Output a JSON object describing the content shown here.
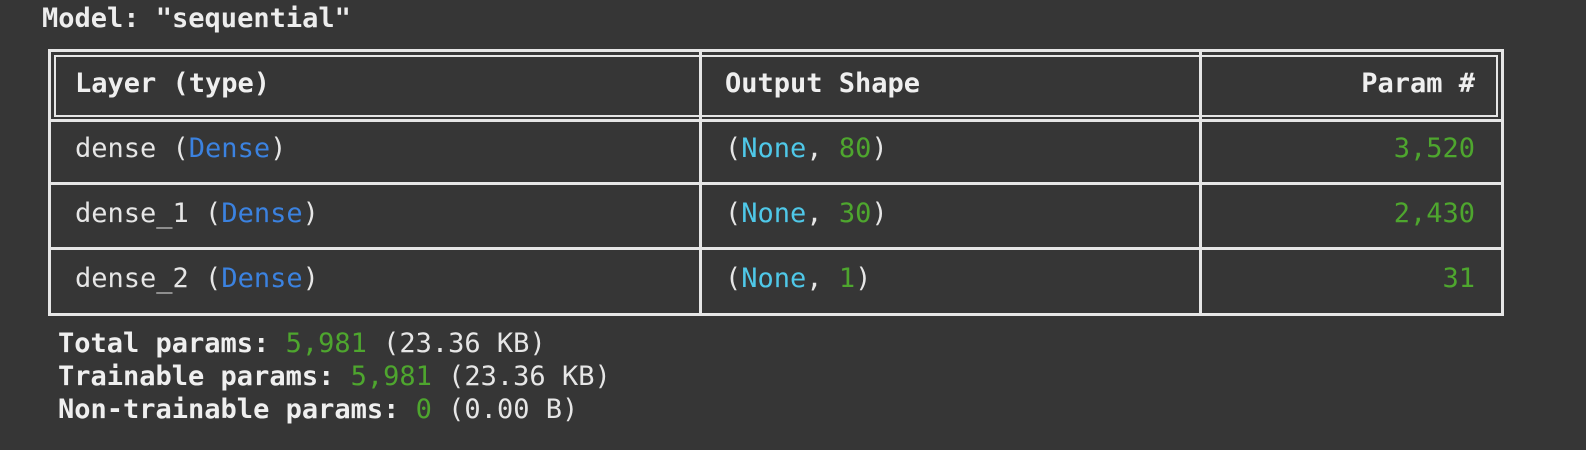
{
  "model_title": "Model: \"sequential\"",
  "table": {
    "headers": {
      "layer": "Layer (type)",
      "output_shape": "Output Shape",
      "params": "Param #"
    },
    "rows": [
      {
        "name": "dense",
        "type": "Dense",
        "shape_none": "None",
        "shape_units": "80",
        "params": "3,520"
      },
      {
        "name": "dense_1",
        "type": "Dense",
        "shape_none": "None",
        "shape_units": "30",
        "params": "2,430"
      },
      {
        "name": "dense_2",
        "type": "Dense",
        "shape_none": "None",
        "shape_units": "1",
        "params": "31"
      }
    ]
  },
  "summary": {
    "total": {
      "label": "Total params:",
      "value": "5,981",
      "size": "(23.36 KB)"
    },
    "trainable": {
      "label": "Trainable params:",
      "value": "5,981",
      "size": "(23.36 KB)"
    },
    "non_trainable": {
      "label": "Non-trainable params:",
      "value": "0",
      "size": "(0.00 B)"
    }
  },
  "colors": {
    "background": "#363636",
    "border": "#e6e6e6",
    "type_blue": "#3b82e0",
    "none_cyan": "#4fc8e8",
    "number_green": "#4ea62e"
  }
}
